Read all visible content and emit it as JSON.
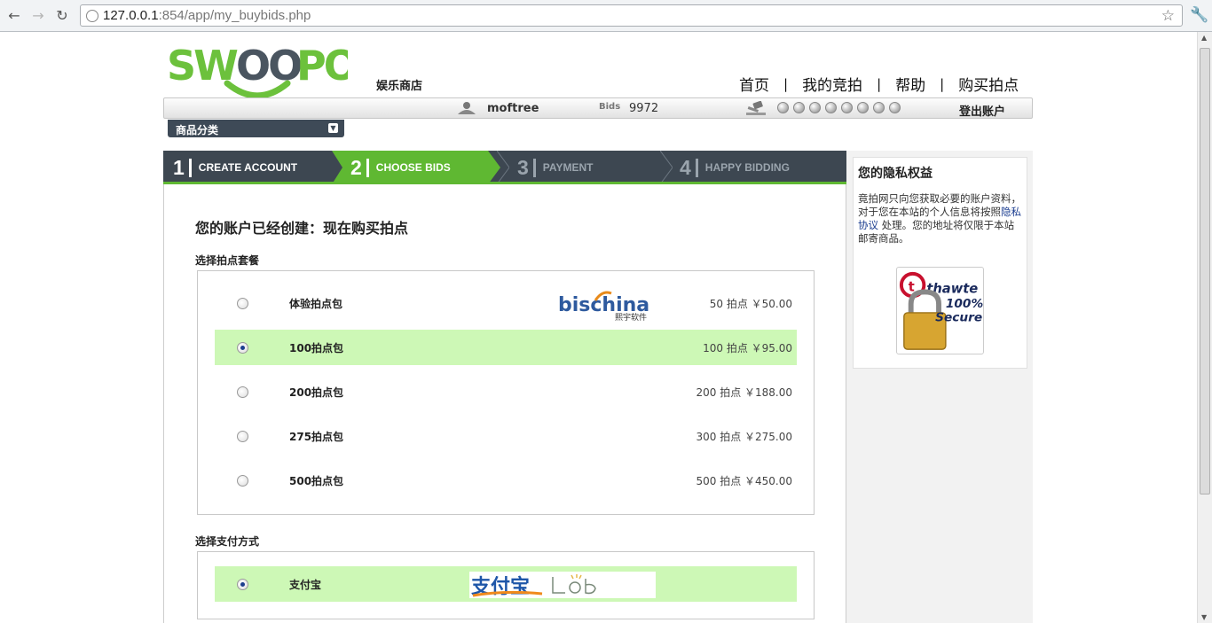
{
  "browser": {
    "url_host": "127.0.0.1",
    "url_rest": ":854/app/my_buybids.php"
  },
  "header": {
    "store_link": "娱乐商店",
    "nav": [
      "首页",
      "我的竞拍",
      "帮助",
      "购买拍点"
    ],
    "separator": "|",
    "username": "moftree",
    "bids_label": "Bids",
    "bids_value": "9972",
    "logout": "登出账户",
    "category_button": "商品分类"
  },
  "steps": [
    {
      "num": "1",
      "label": "CREATE ACCOUNT",
      "state": "done"
    },
    {
      "num": "2",
      "label": "CHOOSE BIDS",
      "state": "active"
    },
    {
      "num": "3",
      "label": "PAYMENT",
      "state": "pending"
    },
    {
      "num": "4",
      "label": "HAPPY BIDDING",
      "state": "pending"
    }
  ],
  "main": {
    "heading": "您的账户已经创建：现在购买拍点",
    "packages_title": "选择拍点套餐",
    "packages": [
      {
        "name": "体验拍点包",
        "price": "50 拍点 ￥50.00",
        "selected": false
      },
      {
        "name": "100拍点包",
        "price": "100 拍点 ￥95.00",
        "selected": true
      },
      {
        "name": "200拍点包",
        "price": "200 拍点 ￥188.00",
        "selected": false
      },
      {
        "name": "275拍点包",
        "price": "300 拍点 ￥275.00",
        "selected": false
      },
      {
        "name": "500拍点包",
        "price": "500 拍点 ￥450.00",
        "selected": false
      }
    ],
    "bischina_text": "bischina",
    "bischina_sub": "熙宇软件",
    "payment_title": "选择支付方式",
    "payment_methods": [
      {
        "name": "支付宝",
        "selected": true
      }
    ],
    "alipay_text": "支付宝"
  },
  "sidebar": {
    "title": "您的隐私权益",
    "text_before": "竟拍网只向您获取必要的账户资料，对于您在本站的个人信息将按照",
    "link": "隐私协议",
    "text_after": "处理。您的地址将仅限于本站邮寄商品。",
    "thawte_brand": "thawte",
    "thawte_line1": "100%",
    "thawte_line2": "Secure"
  },
  "colors": {
    "accent_green": "#5fb832",
    "selected_row": "#cdf8b6",
    "steps_bg": "#3d4751"
  }
}
